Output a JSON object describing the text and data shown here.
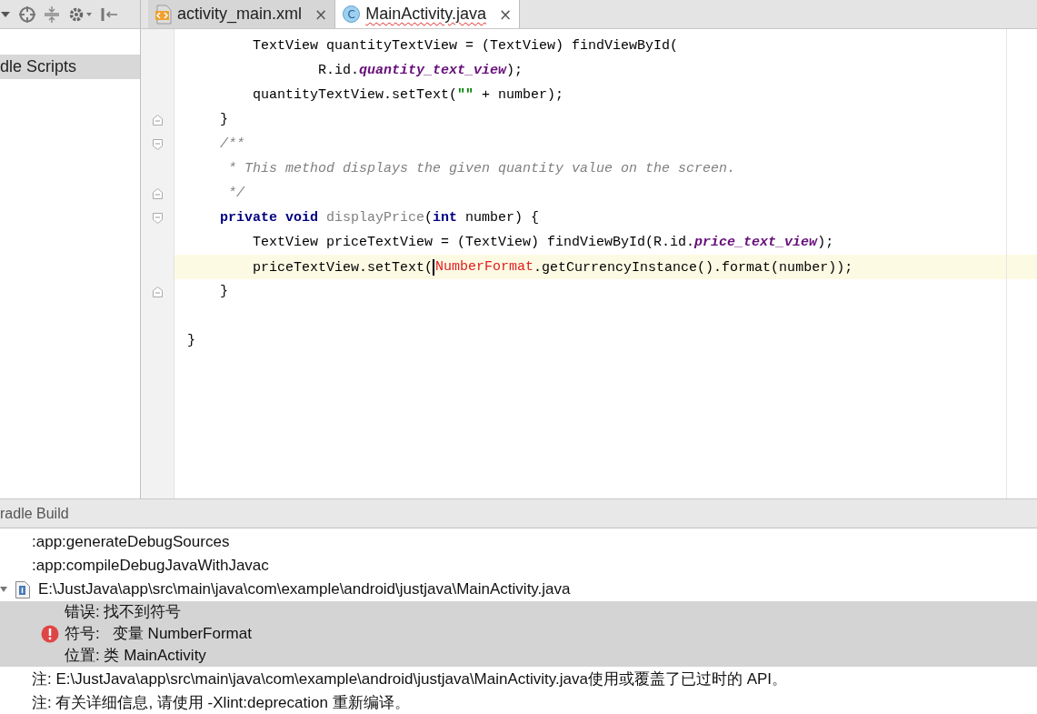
{
  "tabs": [
    {
      "label": "activity_main.xml",
      "kind": "xml",
      "selected": false,
      "has_error": false,
      "close": "×"
    },
    {
      "label": "MainActivity.java",
      "kind": "class",
      "icon_text": "C",
      "selected": true,
      "has_error": true,
      "close": "×"
    }
  ],
  "sidebar": {
    "items": [
      {
        "label": "dle Scripts",
        "selected": true
      }
    ]
  },
  "editor": {
    "lines": [
      {
        "fold_start": false,
        "fold_end": false,
        "current": false,
        "tokens": [
          {
            "kind": "plain",
            "text": "        TextView quantityTextView = (TextView) findViewById("
          }
        ]
      },
      {
        "fold_start": false,
        "fold_end": false,
        "current": false,
        "tokens": [
          {
            "kind": "plain",
            "text": "                R.id."
          },
          {
            "kind": "field",
            "text": "quantity_text_view"
          },
          {
            "kind": "plain",
            "text": ");"
          }
        ]
      },
      {
        "fold_start": false,
        "fold_end": false,
        "current": false,
        "tokens": [
          {
            "kind": "plain",
            "text": "        quantityTextView.setText("
          },
          {
            "kind": "string",
            "text": "\"\""
          },
          {
            "kind": "plain",
            "text": " + number);"
          }
        ]
      },
      {
        "fold_start": false,
        "fold_end": true,
        "current": false,
        "tokens": [
          {
            "kind": "plain",
            "text": "    }"
          }
        ]
      },
      {
        "fold_start": true,
        "fold_end": false,
        "current": false,
        "tokens": [
          {
            "kind": "comment",
            "text": "    /**"
          }
        ]
      },
      {
        "fold_start": false,
        "fold_end": false,
        "current": false,
        "tokens": [
          {
            "kind": "comment",
            "text": "     * This method displays the given quantity value on the screen."
          }
        ]
      },
      {
        "fold_start": false,
        "fold_end": true,
        "current": false,
        "tokens": [
          {
            "kind": "comment",
            "text": "     */"
          }
        ]
      },
      {
        "fold_start": true,
        "fold_end": false,
        "current": false,
        "tokens": [
          {
            "kind": "keyword",
            "text": "    private void"
          },
          {
            "kind": "unused",
            "text": " displayPrice"
          },
          {
            "kind": "plain",
            "text": "("
          },
          {
            "kind": "keyword",
            "text": "int"
          },
          {
            "kind": "plain",
            "text": " number) {"
          }
        ]
      },
      {
        "fold_start": false,
        "fold_end": false,
        "current": false,
        "tokens": [
          {
            "kind": "plain",
            "text": "        TextView priceTextView = (TextView) findViewById(R.id."
          },
          {
            "kind": "field",
            "text": "price_text_view"
          },
          {
            "kind": "plain",
            "text": ");"
          }
        ]
      },
      {
        "fold_start": false,
        "fold_end": false,
        "current": true,
        "tokens": [
          {
            "kind": "plain",
            "text": "        priceTextView.setText("
          },
          {
            "kind": "error",
            "text": "NumberFormat"
          },
          {
            "kind": "plain",
            "text": ".getCurrencyInstance().format(number));"
          }
        ]
      },
      {
        "fold_start": false,
        "fold_end": true,
        "current": false,
        "tokens": [
          {
            "kind": "plain",
            "text": "    }"
          }
        ]
      },
      {
        "fold_start": false,
        "fold_end": false,
        "current": false
      },
      {
        "fold_start": false,
        "fold_end": false,
        "current": false,
        "tokens": [
          {
            "kind": "plain",
            "text": "}"
          }
        ]
      }
    ]
  },
  "build_panel": {
    "title": "radle Build",
    "items": [
      {
        "kind": "task",
        "text": ":app:generateDebugSources",
        "selected": false
      },
      {
        "kind": "task",
        "text": ":app:compileDebugJavaWithJavac",
        "selected": false
      },
      {
        "kind": "file",
        "text": "E:\\JustJava\\app\\src\\main\\java\\com\\example\\android\\justjava\\MainActivity.java",
        "selected": false,
        "expanded": true,
        "children": [
          {
            "kind": "error",
            "selected": true,
            "lines": [
              "错误: 找不到符号",
              "符号:   变量 NumberFormat",
              "位置: 类 MainActivity"
            ]
          }
        ]
      },
      {
        "kind": "task",
        "text": "注: E:\\JustJava\\app\\src\\main\\java\\com\\example\\android\\justjava\\MainActivity.java使用或覆盖了已过时的 API。",
        "selected": false
      },
      {
        "kind": "task",
        "text": "注: 有关详细信息, 请使用 -Xlint:deprecation 重新编译。",
        "selected": false
      }
    ]
  }
}
